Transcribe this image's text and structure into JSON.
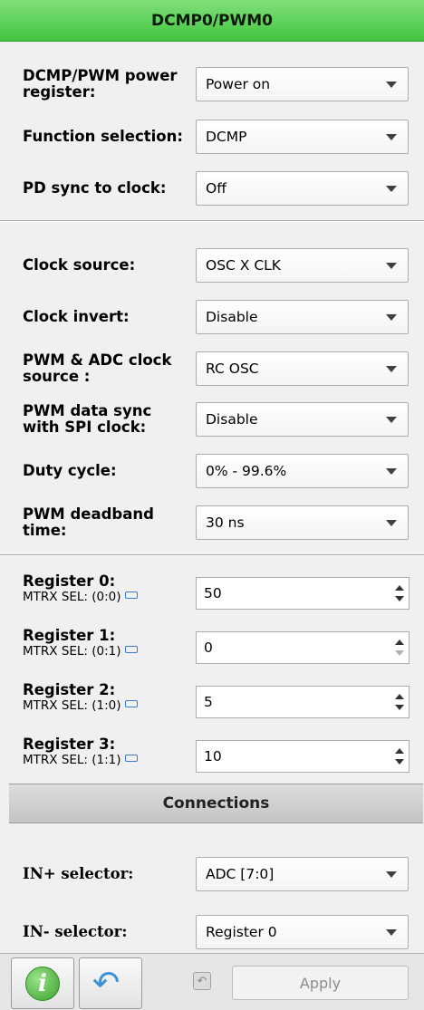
{
  "panel": {
    "title": "DCMP0/PWM0"
  },
  "power_section": [
    {
      "label": "DCMP/PWM power register:",
      "value": "Power on"
    },
    {
      "label": "Function selection:",
      "value": "DCMP"
    },
    {
      "label": "PD sync to clock:",
      "value": "Off"
    }
  ],
  "clock_section": [
    {
      "label": "Clock source:",
      "value": "OSC X CLK"
    },
    {
      "label": "Clock invert:",
      "value": "Disable"
    },
    {
      "label": "PWM & ADC clock source :",
      "value": "RC OSC"
    },
    {
      "label": "PWM data sync with SPI clock:",
      "value": "Disable"
    },
    {
      "label": "Duty cycle:",
      "value": "0% - 99.6%"
    },
    {
      "label": "PWM deadband time:",
      "value": "30 ns"
    }
  ],
  "registers": [
    {
      "title": "Register 0:",
      "sub": "MTRX SEL: (0:0)",
      "value": "50"
    },
    {
      "title": "Register 1:",
      "sub": "MTRX SEL: (0:1)",
      "value": "0"
    },
    {
      "title": "Register 2:",
      "sub": "MTRX SEL: (1:0)",
      "value": "5"
    },
    {
      "title": "Register 3:",
      "sub": "MTRX SEL: (1:1)",
      "value": "10"
    }
  ],
  "connections": {
    "title": "Connections",
    "items": [
      {
        "label": "IN+ selector:",
        "value": "ADC [7:0]"
      },
      {
        "label": "IN- selector:",
        "value": "Register 0"
      }
    ]
  },
  "footer": {
    "apply_label": "Apply"
  },
  "icons": {
    "info": "info-icon",
    "undo": "undo-icon",
    "small_undo": "small-undo-icon",
    "link": "link-icon",
    "dropdown": "chevron-down-icon"
  },
  "colors": {
    "header_green": "#45c43f",
    "link_blue": "#3a7bd5"
  }
}
